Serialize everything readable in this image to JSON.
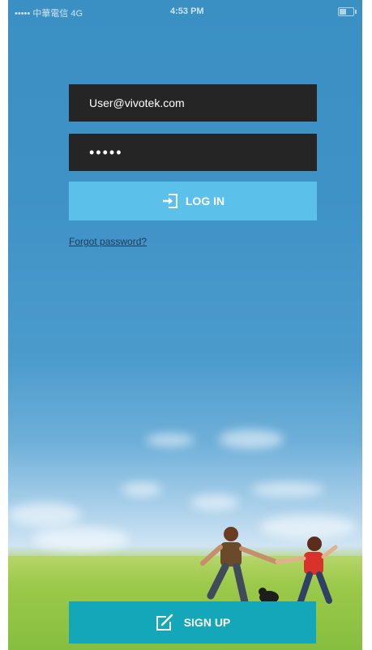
{
  "status_bar": {
    "carrier": "•••••  中華電信  4G",
    "time": "4:53 PM"
  },
  "login": {
    "username_value": "User@vivotek.com",
    "password_value": "•••••",
    "login_label": "LOG IN",
    "forgot_label": "Forgot password?"
  },
  "signup": {
    "label": "SIGN UP"
  },
  "colors": {
    "login_button": "#5cc1ea",
    "signup_button": "#13a7b9",
    "field_background": "#252526"
  },
  "icons": {
    "login": "login-arrow-icon",
    "signup": "edit-pencil-icon"
  }
}
